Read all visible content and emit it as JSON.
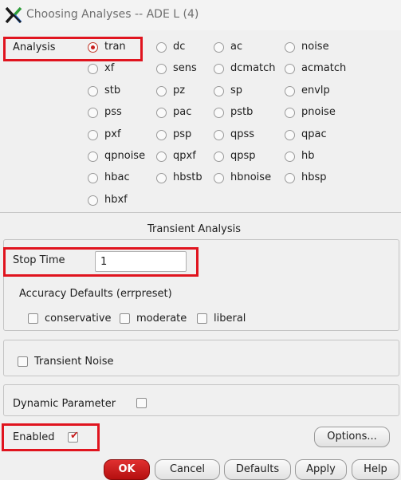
{
  "window": {
    "title": "Choosing Analyses -- ADE L (4)"
  },
  "analysis": {
    "label": "Analysis",
    "selected": "tran",
    "options": [
      [
        "tran",
        "dc",
        "ac",
        "noise"
      ],
      [
        "xf",
        "sens",
        "dcmatch",
        "acmatch"
      ],
      [
        "stb",
        "pz",
        "sp",
        "envlp"
      ],
      [
        "pss",
        "pac",
        "pstb",
        "pnoise"
      ],
      [
        "pxf",
        "psp",
        "qpss",
        "qpac"
      ],
      [
        "qpnoise",
        "qpxf",
        "qpsp",
        "hb"
      ],
      [
        "hbac",
        "hbstb",
        "hbnoise",
        "hbsp"
      ],
      [
        "hbxf"
      ]
    ]
  },
  "transient": {
    "section_title": "Transient Analysis",
    "stop_time_label": "Stop Time",
    "stop_time_value": "1",
    "accuracy_label": "Accuracy Defaults (errpreset)",
    "accuracy_options": [
      "conservative",
      "moderate",
      "liberal"
    ],
    "transient_noise_label": "Transient Noise",
    "dynamic_parameter_label": "Dynamic Parameter"
  },
  "footer": {
    "enabled_label": "Enabled",
    "enabled_checked": true,
    "options_label": "Options...",
    "ok_label": "OK",
    "cancel_label": "Cancel",
    "defaults_label": "Defaults",
    "apply_label": "Apply",
    "help_label": "Help"
  },
  "colors": {
    "highlight_box": "#e0141e",
    "ok_button": "#c81e1e",
    "radio_selected": "#c81e1e"
  }
}
